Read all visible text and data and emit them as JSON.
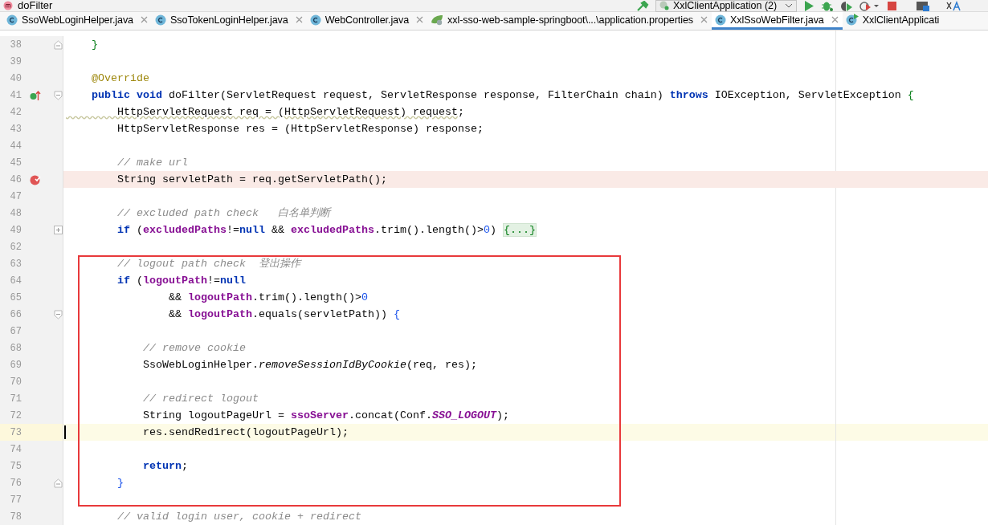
{
  "breadcrumb": {
    "label": "doFilter"
  },
  "run_config": {
    "label": "XxlClientApplication (2)"
  },
  "tabs": [
    {
      "label": "SsoWebLoginHelper.java",
      "kind": "class",
      "closable": true,
      "selected": false
    },
    {
      "label": "SsoTokenLoginHelper.java",
      "kind": "class",
      "closable": true,
      "selected": false
    },
    {
      "label": "WebController.java",
      "kind": "class",
      "closable": true,
      "selected": false
    },
    {
      "label": "xxl-sso-web-sample-springboot\\...\\application.properties",
      "kind": "properties",
      "closable": true,
      "selected": false
    },
    {
      "label": "XxlSsoWebFilter.java",
      "kind": "class",
      "closable": true,
      "selected": true
    },
    {
      "label": "XxlClientApplicati",
      "kind": "app",
      "closable": false,
      "selected": false
    }
  ],
  "lines": [
    {
      "number": "38",
      "fold_end": true,
      "parts": [
        {
          "kind": "brace",
          "text": "    }"
        }
      ]
    },
    {
      "number": "39"
    },
    {
      "number": "40",
      "parts": [
        {
          "kind": "annotation",
          "text": "    @Override"
        }
      ]
    },
    {
      "number": "41",
      "override": true,
      "fold_start": true,
      "parts": [
        {
          "kind": "keyword",
          "text": "    public"
        },
        {
          "kind": "keyword",
          "text": " void"
        },
        {
          "kind": "plain",
          "text": " doFilter(ServletRequest request, ServletResponse response, FilterChain chain) "
        },
        {
          "kind": "keyword",
          "text": "throws"
        },
        {
          "kind": "plain",
          "text": " IOException, ServletException "
        },
        {
          "kind": "brace",
          "text": "{"
        }
      ]
    },
    {
      "number": "42",
      "parts": [
        {
          "kind": "warning",
          "text": "        HttpServletRequest req = (HttpServletRequest) request"
        },
        {
          "kind": "plain",
          "text": ";"
        }
      ]
    },
    {
      "number": "43",
      "parts": [
        {
          "kind": "plain",
          "text": "        HttpServletResponse res = (HttpServletResponse) response;"
        }
      ]
    },
    {
      "number": "44"
    },
    {
      "number": "45",
      "parts": [
        {
          "kind": "comment",
          "text": "        // make url"
        }
      ]
    },
    {
      "number": "46",
      "breakpoint": true,
      "parts": [
        {
          "kind": "plain",
          "text": "        String servletPath = req.getServletPath();"
        }
      ]
    },
    {
      "number": "47"
    },
    {
      "number": "48",
      "parts": [
        {
          "kind": "comment",
          "text": "        // excluded path check   白名单判断"
        }
      ]
    },
    {
      "number": "49",
      "collapsed": true,
      "parts": [
        {
          "kind": "keyword",
          "text": "        if"
        },
        {
          "kind": "plain",
          "text": " ("
        },
        {
          "kind": "field",
          "text": "excludedPaths"
        },
        {
          "kind": "plain",
          "text": "!="
        },
        {
          "kind": "keyword",
          "text": "null"
        },
        {
          "kind": "plain",
          "text": " && "
        },
        {
          "kind": "field",
          "text": "excludedPaths"
        },
        {
          "kind": "plain",
          "text": ".trim().length()>"
        },
        {
          "kind": "number",
          "text": "0"
        },
        {
          "kind": "plain",
          "text": ") "
        },
        {
          "kind": "folded",
          "text": "{...}"
        }
      ]
    },
    {
      "number": "62"
    },
    {
      "number": "63",
      "parts": [
        {
          "kind": "comment",
          "text": "        // logout path check  登出操作"
        }
      ]
    },
    {
      "number": "64",
      "parts": [
        {
          "kind": "keyword",
          "text": "        if"
        },
        {
          "kind": "plain",
          "text": " ("
        },
        {
          "kind": "field",
          "text": "logoutPath"
        },
        {
          "kind": "plain",
          "text": "!="
        },
        {
          "kind": "keyword",
          "text": "null"
        }
      ]
    },
    {
      "number": "65",
      "parts": [
        {
          "kind": "plain",
          "text": "                && "
        },
        {
          "kind": "field",
          "text": "logoutPath"
        },
        {
          "kind": "plain",
          "text": ".trim().length()>"
        },
        {
          "kind": "number",
          "text": "0"
        }
      ]
    },
    {
      "number": "66",
      "fold_start": true,
      "parts": [
        {
          "kind": "plain",
          "text": "                && "
        },
        {
          "kind": "field",
          "text": "logoutPath"
        },
        {
          "kind": "plain",
          "text": ".equals(servletPath)) "
        },
        {
          "kind": "bracket",
          "text": "{"
        }
      ]
    },
    {
      "number": "67"
    },
    {
      "number": "68",
      "parts": [
        {
          "kind": "comment",
          "text": "            // remove cookie"
        }
      ]
    },
    {
      "number": "69",
      "parts": [
        {
          "kind": "plain",
          "text": "            SsoWebLoginHelper."
        },
        {
          "kind": "static_method",
          "text": "removeSessionIdByCookie"
        },
        {
          "kind": "plain",
          "text": "(req, res);"
        }
      ]
    },
    {
      "number": "70"
    },
    {
      "number": "71",
      "parts": [
        {
          "kind": "comment",
          "text": "            // redirect logout"
        }
      ]
    },
    {
      "number": "72",
      "parts": [
        {
          "kind": "plain",
          "text": "            String logoutPageUrl = "
        },
        {
          "kind": "field",
          "text": "ssoServer"
        },
        {
          "kind": "plain",
          "text": ".concat(Conf."
        },
        {
          "kind": "constant",
          "text": "SSO_LOGOUT"
        },
        {
          "kind": "plain",
          "text": ");"
        }
      ]
    },
    {
      "number": "73",
      "current": true,
      "parts": [
        {
          "kind": "plain",
          "text": "            res.sendRedirect(logoutPageUrl);"
        }
      ]
    },
    {
      "number": "74"
    },
    {
      "number": "75",
      "parts": [
        {
          "kind": "keyword",
          "text": "            return"
        },
        {
          "kind": "plain",
          "text": ";"
        }
      ]
    },
    {
      "number": "76",
      "fold_end": true,
      "parts": [
        {
          "kind": "bracket",
          "text": "        }"
        }
      ]
    },
    {
      "number": "77"
    },
    {
      "number": "78",
      "parts": [
        {
          "kind": "comment",
          "text": "        // valid login user, cookie + redirect"
        }
      ]
    }
  ]
}
